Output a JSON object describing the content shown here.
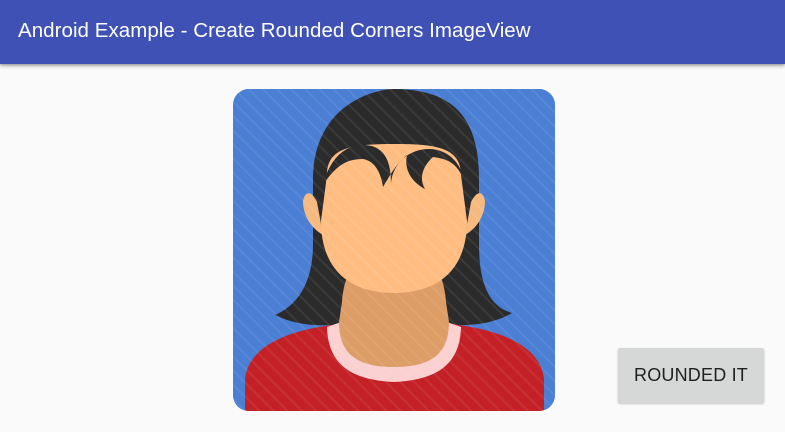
{
  "app_bar": {
    "title": "Android Example - Create Rounded Corners ImageView",
    "color": "#3f51b5"
  },
  "image_view": {
    "icon": "person-avatar-icon",
    "background_color": "#4a7fd4",
    "corner_style": "rounded"
  },
  "actions": {
    "rounded_button_label": "ROUNDED IT"
  }
}
